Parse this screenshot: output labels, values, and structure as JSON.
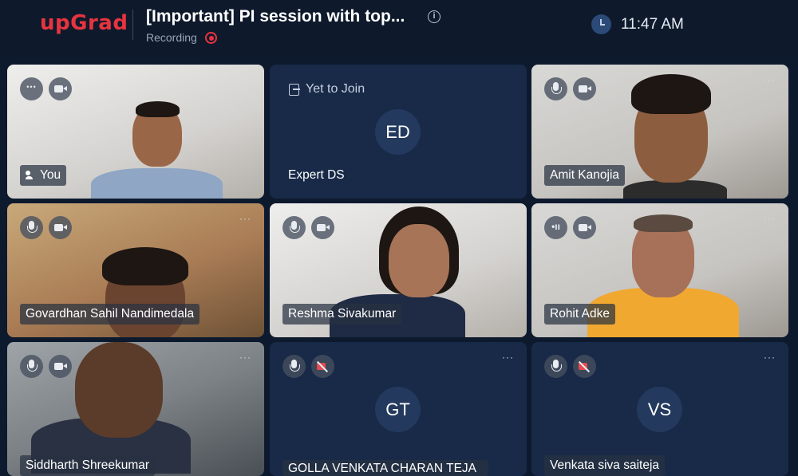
{
  "header": {
    "logo": "upGrad",
    "title": "[Important] PI session with top...",
    "recording_label": "Recording",
    "time": "11:47 AM"
  },
  "participants": [
    {
      "name": "You",
      "status": "video",
      "more": "···"
    },
    {
      "name": "Expert DS",
      "status": "Yet to Join",
      "initials": "ED"
    },
    {
      "name": "Amit Kanojia",
      "status": "video",
      "more": "···"
    },
    {
      "name": "Govardhan Sahil Nandimedala",
      "status": "video",
      "more": "···"
    },
    {
      "name": "Reshma Sivakumar",
      "status": "video",
      "more": "···"
    },
    {
      "name": "Rohit Adke",
      "status": "video",
      "more": "···"
    },
    {
      "name": "Siddharth Shreekumar",
      "status": "video",
      "more": "···"
    },
    {
      "name": "GOLLA VENKATA CHARAN TEJA",
      "status": "camera-off",
      "initials": "GT",
      "more": "···"
    },
    {
      "name": "Venkata siva saiteja",
      "status": "camera-off",
      "initials": "VS",
      "more": "···"
    }
  ],
  "icons": {
    "info": "info-icon",
    "recording": "record-dot-icon",
    "clock": "clock-icon",
    "mic": "microphone-icon",
    "camera": "video-camera-icon",
    "camera_off": "video-camera-off-icon",
    "more": "more-options-icon",
    "join": "door-icon",
    "speaking": "speaking-icon"
  },
  "colors": {
    "brand": "#e8343f",
    "background": "#0d1a2e",
    "tile": "#182a48",
    "avatar": "#233a5e"
  }
}
